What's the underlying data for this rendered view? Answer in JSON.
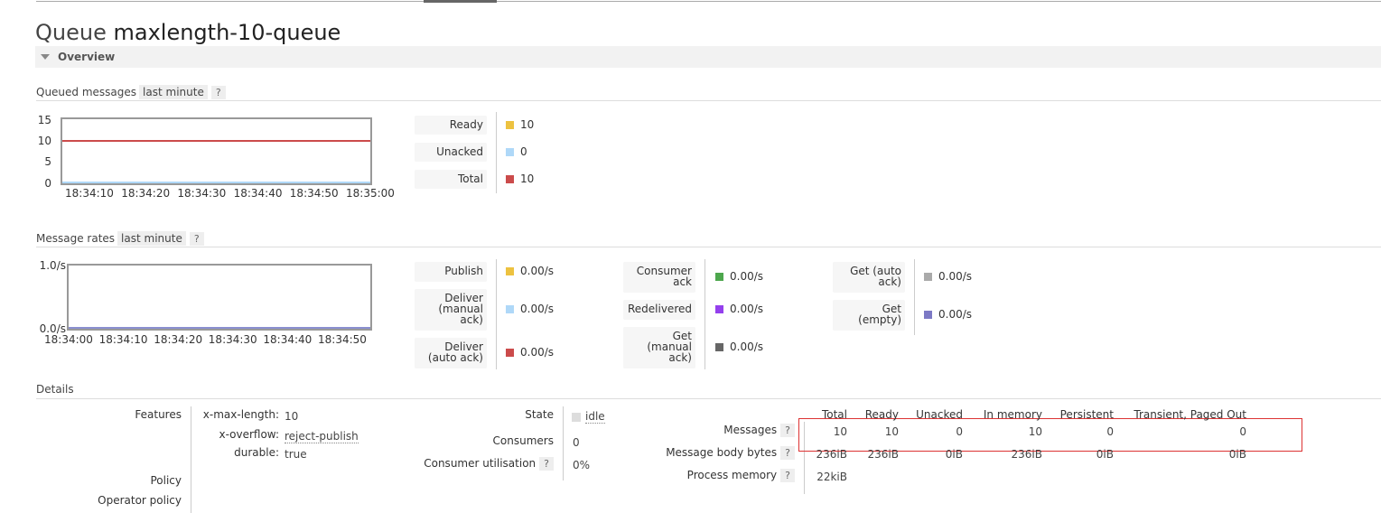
{
  "page": {
    "title_prefix": "Queue",
    "queue_name": "maxlength-10-queue",
    "section_overview": "Overview"
  },
  "queued_messages": {
    "heading": "Queued messages",
    "range": "last minute",
    "help": "?",
    "y_ticks": [
      "15",
      "10",
      "5",
      "0"
    ],
    "x_ticks": [
      "18:34:10",
      "18:34:20",
      "18:34:30",
      "18:34:40",
      "18:34:50",
      "18:35:00"
    ],
    "legend": [
      {
        "label": "Ready",
        "value": "10",
        "color": "#edc240"
      },
      {
        "label": "Unacked",
        "value": "0",
        "color": "#afd8f8"
      },
      {
        "label": "Total",
        "value": "10",
        "color": "#cb4b4b"
      }
    ]
  },
  "message_rates": {
    "heading": "Message rates",
    "range": "last minute",
    "help": "?",
    "y_ticks": [
      "1.0/s",
      "0.0/s"
    ],
    "x_ticks": [
      "18:34:00",
      "18:34:10",
      "18:34:20",
      "18:34:30",
      "18:34:40",
      "18:34:50"
    ],
    "col1": [
      {
        "label": "Publish",
        "value": "0.00/s",
        "color": "#edc240"
      },
      {
        "label": "Deliver\n(manual\nack)",
        "value": "0.00/s",
        "color": "#afd8f8"
      },
      {
        "label": "Deliver\n(auto ack)",
        "value": "0.00/s",
        "color": "#cb4b4b"
      }
    ],
    "col2": [
      {
        "label": "Consumer\nack",
        "value": "0.00/s",
        "color": "#4da74d"
      },
      {
        "label": "Redelivered",
        "value": "0.00/s",
        "color": "#9440ed"
      },
      {
        "label": "Get\n(manual\nack)",
        "value": "0.00/s",
        "color": "#666666"
      }
    ],
    "col3": [
      {
        "label": "Get (auto\nack)",
        "value": "0.00/s",
        "color": "#aaaaaa"
      },
      {
        "label": "Get\n(empty)",
        "value": "0.00/s",
        "color": "#7c79c5"
      }
    ]
  },
  "chart_data": [
    {
      "type": "line",
      "x": [
        "18:34:10",
        "18:34:20",
        "18:34:30",
        "18:34:40",
        "18:34:50",
        "18:35:00"
      ],
      "series": [
        {
          "name": "Ready",
          "values": [
            10,
            10,
            10,
            10,
            10,
            10
          ]
        },
        {
          "name": "Unacked",
          "values": [
            0,
            0,
            0,
            0,
            0,
            0
          ]
        },
        {
          "name": "Total",
          "values": [
            10,
            10,
            10,
            10,
            10,
            10
          ]
        }
      ],
      "ylim": [
        0,
        15
      ]
    },
    {
      "type": "line",
      "x": [
        "18:34:00",
        "18:34:10",
        "18:34:20",
        "18:34:30",
        "18:34:40",
        "18:34:50"
      ],
      "series": [
        {
          "name": "Publish",
          "values": [
            0,
            0,
            0,
            0,
            0,
            0
          ]
        }
      ],
      "ylim": [
        0,
        1
      ]
    }
  ],
  "details": {
    "heading": "Details",
    "features_label": "Features",
    "features": [
      {
        "key": "x-max-length:",
        "value": "10"
      },
      {
        "key": "x-overflow:",
        "value": "reject-publish"
      },
      {
        "key": "durable:",
        "value": "true"
      }
    ],
    "policy_label": "Policy",
    "operator_policy_label": "Operator policy",
    "state_label": "State",
    "state_value": "idle",
    "consumers_label": "Consumers",
    "consumers_value": "0",
    "consumer_util_label": "Consumer utilisation",
    "consumer_util_value": "0%",
    "help": "?",
    "table_headers": [
      "Total",
      "Ready",
      "Unacked",
      "In memory",
      "Persistent",
      "Transient, Paged Out"
    ],
    "rows": [
      {
        "label": "Messages",
        "values": [
          "10",
          "10",
          "0",
          "10",
          "0",
          "0"
        ]
      },
      {
        "label": "Message body bytes",
        "values": [
          "236iB",
          "236iB",
          "0iB",
          "236iB",
          "0iB",
          "0iB"
        ]
      },
      {
        "label": "Process memory",
        "values": [
          "22kiB"
        ]
      }
    ]
  }
}
